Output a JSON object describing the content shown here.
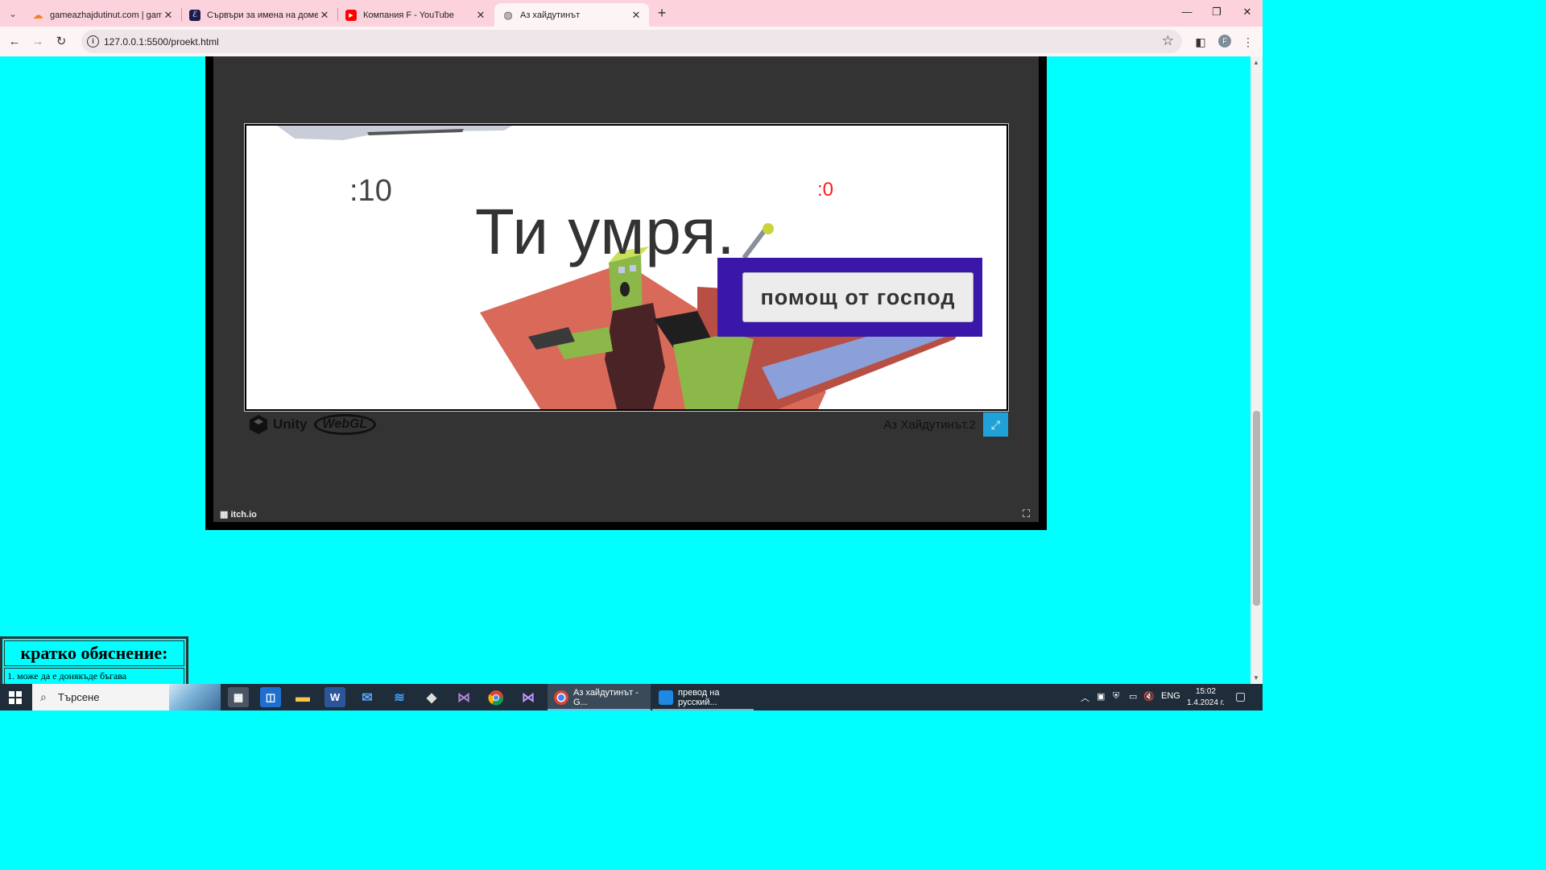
{
  "browser": {
    "tabs": [
      {
        "title": "gameazhajdutinut.com | gameaz",
        "favicon": "cloud-icon",
        "color": "#f48120",
        "active": false
      },
      {
        "title": "Сървъри за имена на домейни",
        "favicon": "domain-icon",
        "color": "#1a1a4e",
        "active": false
      },
      {
        "title": "Компания F - YouTube",
        "favicon": "youtube-icon",
        "color": "#ff0000",
        "active": false
      },
      {
        "title": "Аз хайдутинът",
        "favicon": "globe-icon",
        "color": "#555555",
        "active": true
      }
    ],
    "url": "127.0.0.1:5500/proekt.html",
    "profile_initial": "F"
  },
  "game": {
    "score_left": ":10",
    "score_right": ":0",
    "death_message": "Ти умря.",
    "help_button_label": "помощ от господ",
    "title": "Аз Хайдутинът.2",
    "unity_label": "Unity",
    "webgl_label": "WebGL",
    "itch_label": "itch.io",
    "colors": {
      "help_panel": "#3a17a8",
      "fullscreen_button": "#1ea2d8",
      "score_right": "#ff1a1a"
    }
  },
  "info_table": {
    "title": "кратко обяснение:",
    "rows": [
      "1. може да е донякъде бъгава"
    ]
  },
  "taskbar": {
    "search_placeholder": "Търсене",
    "open_windows": [
      {
        "label": "Аз хайдутинът - G...",
        "app": "chrome"
      },
      {
        "label": "превод на русский...",
        "app": "vscode"
      }
    ],
    "language": "ENG",
    "time": "15:02",
    "date": "1.4.2024 г."
  }
}
